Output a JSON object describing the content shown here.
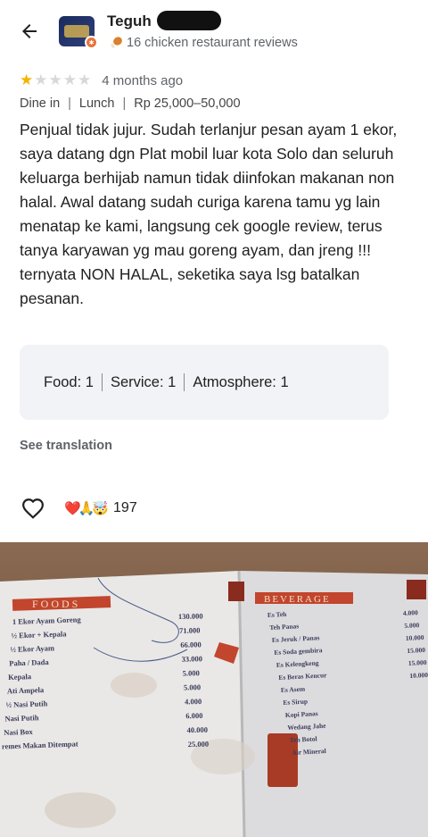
{
  "reviewer": {
    "name": "Teguh",
    "reviews_count": "16 chicken restaurant reviews"
  },
  "review": {
    "rating": 1,
    "max_rating": 5,
    "time": "4 months ago",
    "dine_type": "Dine in",
    "meal": "Lunch",
    "price": "Rp 25,000–50,000",
    "text": "Penjual tidak jujur. Sudah terlanjur pesan ayam 1 ekor, saya datang dgn Plat mobil luar kota Solo dan seluruh keluarga berhijab namun tidak diinfokan makanan non halal. Awal datang sudah curiga karena tamu yg lain menatap ke kami, langsung cek google review, terus tanya karyawan yg mau goreng ayam, dan jreng !!! ternyata NON HALAL, seketika saya lsg batalkan pesanan.",
    "sub_ratings": {
      "food": "Food: 1",
      "service": "Service: 1",
      "atmosphere": "Atmosphere: 1"
    },
    "see_translation": "See translation",
    "reactions": "❤️🙏🤯",
    "reaction_count": "197"
  },
  "menu_photo": {
    "foods_header": "FOODS",
    "beverage_header": "BEVERAGE",
    "foods": [
      {
        "name": "1 Ekor Ayam Goreng",
        "price": "130.000"
      },
      {
        "name": "½ Ekor + Kepala",
        "price": "71.000"
      },
      {
        "name": "½ Ekor Ayam",
        "price": "66.000"
      },
      {
        "name": "Paha / Dada",
        "price": "33.000"
      },
      {
        "name": "Kepala",
        "price": "5.000"
      },
      {
        "name": "Ati Ampela",
        "price": "5.000"
      },
      {
        "name": "½ Nasi Putih",
        "price": "4.000"
      },
      {
        "name": "Nasi Putih",
        "price": "6.000"
      },
      {
        "name": "Nasi Box",
        "price": "40.000"
      },
      {
        "name": "remes Makan Ditempat",
        "price": "25.000"
      }
    ],
    "beverages": [
      {
        "name": "Es Teh",
        "price": "4.000"
      },
      {
        "name": "Teh Panas",
        "price": "5.000"
      },
      {
        "name": "Es Jeruk / Panas",
        "price": "10.000"
      },
      {
        "name": "Es Soda gembira",
        "price": "15.000"
      },
      {
        "name": "Es Kelengkeng",
        "price": "15.000"
      },
      {
        "name": "Es Beras Kencur",
        "price": "10.000"
      },
      {
        "name": "Es Asem",
        "price": ""
      },
      {
        "name": "Es Sirup",
        "price": ""
      },
      {
        "name": "Kopi Panas",
        "price": ""
      },
      {
        "name": "Wedang Jahe",
        "price": ""
      },
      {
        "name": "Teh Botol",
        "price": ""
      },
      {
        "name": "Air Mineral",
        "price": ""
      }
    ]
  },
  "colors": {
    "star_on": "#f4b400",
    "star_off": "#d8d8d8",
    "badge": "#e8743b",
    "box_bg": "#f1f3f6"
  }
}
